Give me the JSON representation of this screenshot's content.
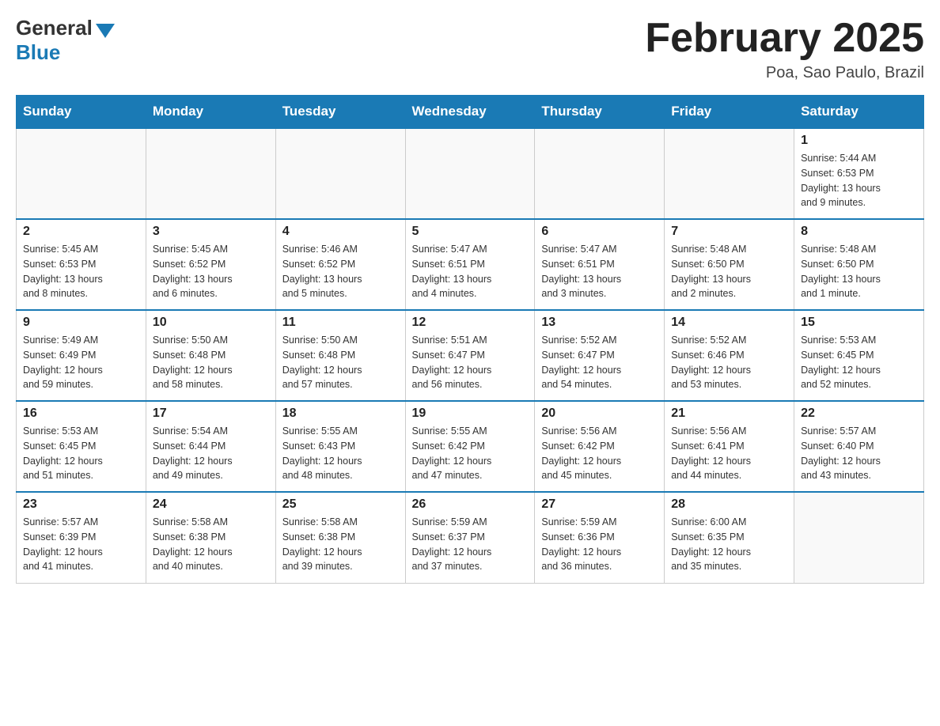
{
  "header": {
    "logo_general": "General",
    "logo_blue": "Blue",
    "month_title": "February 2025",
    "location": "Poa, Sao Paulo, Brazil"
  },
  "weekdays": [
    "Sunday",
    "Monday",
    "Tuesday",
    "Wednesday",
    "Thursday",
    "Friday",
    "Saturday"
  ],
  "weeks": [
    {
      "days": [
        {
          "num": "",
          "info": ""
        },
        {
          "num": "",
          "info": ""
        },
        {
          "num": "",
          "info": ""
        },
        {
          "num": "",
          "info": ""
        },
        {
          "num": "",
          "info": ""
        },
        {
          "num": "",
          "info": ""
        },
        {
          "num": "1",
          "info": "Sunrise: 5:44 AM\nSunset: 6:53 PM\nDaylight: 13 hours\nand 9 minutes."
        }
      ]
    },
    {
      "days": [
        {
          "num": "2",
          "info": "Sunrise: 5:45 AM\nSunset: 6:53 PM\nDaylight: 13 hours\nand 8 minutes."
        },
        {
          "num": "3",
          "info": "Sunrise: 5:45 AM\nSunset: 6:52 PM\nDaylight: 13 hours\nand 6 minutes."
        },
        {
          "num": "4",
          "info": "Sunrise: 5:46 AM\nSunset: 6:52 PM\nDaylight: 13 hours\nand 5 minutes."
        },
        {
          "num": "5",
          "info": "Sunrise: 5:47 AM\nSunset: 6:51 PM\nDaylight: 13 hours\nand 4 minutes."
        },
        {
          "num": "6",
          "info": "Sunrise: 5:47 AM\nSunset: 6:51 PM\nDaylight: 13 hours\nand 3 minutes."
        },
        {
          "num": "7",
          "info": "Sunrise: 5:48 AM\nSunset: 6:50 PM\nDaylight: 13 hours\nand 2 minutes."
        },
        {
          "num": "8",
          "info": "Sunrise: 5:48 AM\nSunset: 6:50 PM\nDaylight: 13 hours\nand 1 minute."
        }
      ]
    },
    {
      "days": [
        {
          "num": "9",
          "info": "Sunrise: 5:49 AM\nSunset: 6:49 PM\nDaylight: 12 hours\nand 59 minutes."
        },
        {
          "num": "10",
          "info": "Sunrise: 5:50 AM\nSunset: 6:48 PM\nDaylight: 12 hours\nand 58 minutes."
        },
        {
          "num": "11",
          "info": "Sunrise: 5:50 AM\nSunset: 6:48 PM\nDaylight: 12 hours\nand 57 minutes."
        },
        {
          "num": "12",
          "info": "Sunrise: 5:51 AM\nSunset: 6:47 PM\nDaylight: 12 hours\nand 56 minutes."
        },
        {
          "num": "13",
          "info": "Sunrise: 5:52 AM\nSunset: 6:47 PM\nDaylight: 12 hours\nand 54 minutes."
        },
        {
          "num": "14",
          "info": "Sunrise: 5:52 AM\nSunset: 6:46 PM\nDaylight: 12 hours\nand 53 minutes."
        },
        {
          "num": "15",
          "info": "Sunrise: 5:53 AM\nSunset: 6:45 PM\nDaylight: 12 hours\nand 52 minutes."
        }
      ]
    },
    {
      "days": [
        {
          "num": "16",
          "info": "Sunrise: 5:53 AM\nSunset: 6:45 PM\nDaylight: 12 hours\nand 51 minutes."
        },
        {
          "num": "17",
          "info": "Sunrise: 5:54 AM\nSunset: 6:44 PM\nDaylight: 12 hours\nand 49 minutes."
        },
        {
          "num": "18",
          "info": "Sunrise: 5:55 AM\nSunset: 6:43 PM\nDaylight: 12 hours\nand 48 minutes."
        },
        {
          "num": "19",
          "info": "Sunrise: 5:55 AM\nSunset: 6:42 PM\nDaylight: 12 hours\nand 47 minutes."
        },
        {
          "num": "20",
          "info": "Sunrise: 5:56 AM\nSunset: 6:42 PM\nDaylight: 12 hours\nand 45 minutes."
        },
        {
          "num": "21",
          "info": "Sunrise: 5:56 AM\nSunset: 6:41 PM\nDaylight: 12 hours\nand 44 minutes."
        },
        {
          "num": "22",
          "info": "Sunrise: 5:57 AM\nSunset: 6:40 PM\nDaylight: 12 hours\nand 43 minutes."
        }
      ]
    },
    {
      "days": [
        {
          "num": "23",
          "info": "Sunrise: 5:57 AM\nSunset: 6:39 PM\nDaylight: 12 hours\nand 41 minutes."
        },
        {
          "num": "24",
          "info": "Sunrise: 5:58 AM\nSunset: 6:38 PM\nDaylight: 12 hours\nand 40 minutes."
        },
        {
          "num": "25",
          "info": "Sunrise: 5:58 AM\nSunset: 6:38 PM\nDaylight: 12 hours\nand 39 minutes."
        },
        {
          "num": "26",
          "info": "Sunrise: 5:59 AM\nSunset: 6:37 PM\nDaylight: 12 hours\nand 37 minutes."
        },
        {
          "num": "27",
          "info": "Sunrise: 5:59 AM\nSunset: 6:36 PM\nDaylight: 12 hours\nand 36 minutes."
        },
        {
          "num": "28",
          "info": "Sunrise: 6:00 AM\nSunset: 6:35 PM\nDaylight: 12 hours\nand 35 minutes."
        },
        {
          "num": "",
          "info": ""
        }
      ]
    }
  ]
}
